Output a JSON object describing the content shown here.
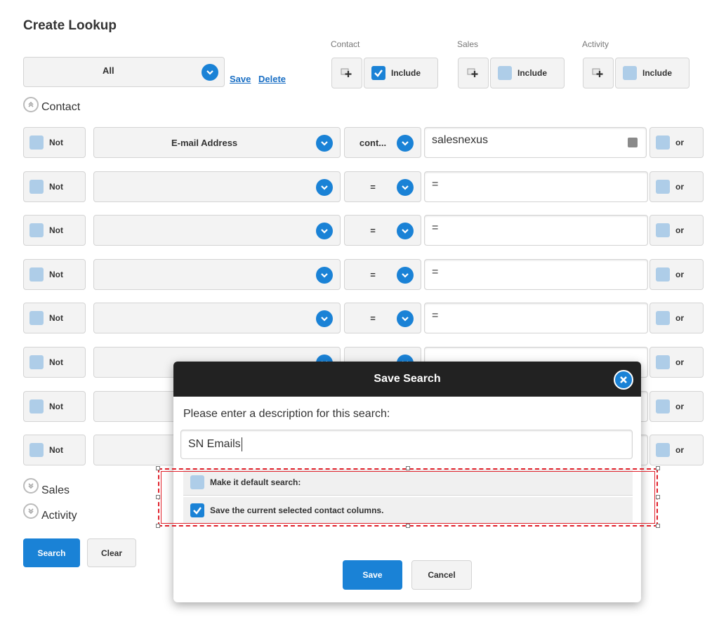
{
  "page": {
    "title": "Create Lookup"
  },
  "columns": {
    "contact": "Contact",
    "sales": "Sales",
    "activity": "Activity"
  },
  "lookup": {
    "selected": "All",
    "save_link": "Save",
    "delete_link": "Delete"
  },
  "include": {
    "label": "Include",
    "contact_checked": true,
    "sales_checked": false,
    "activity_checked": false
  },
  "sections": {
    "contact": "Contact",
    "sales": "Sales",
    "activity": "Activity"
  },
  "filters": {
    "not_label": "Not",
    "or_label": "or",
    "rows": [
      {
        "field": "E-mail Address",
        "operator": "cont...",
        "value": "salesnexus"
      },
      {
        "field": "",
        "operator": "=",
        "value": "="
      },
      {
        "field": "",
        "operator": "=",
        "value": "="
      },
      {
        "field": "",
        "operator": "=",
        "value": "="
      },
      {
        "field": "",
        "operator": "=",
        "value": "="
      },
      {
        "field": "",
        "operator": "",
        "value": ""
      },
      {
        "field": "",
        "operator": "",
        "value": ""
      },
      {
        "field": "",
        "operator": "",
        "value": ""
      }
    ]
  },
  "actions": {
    "search": "Search",
    "clear": "Clear"
  },
  "dialog": {
    "title": "Save Search",
    "prompt": "Please enter a description for this search:",
    "description_value": "SN Emails",
    "option_default": "Make it default search:",
    "option_default_checked": false,
    "option_columns": "Save the current selected contact columns.",
    "option_columns_checked": true,
    "save": "Save",
    "cancel": "Cancel"
  },
  "colors": {
    "accent": "#1a82d6",
    "header": "#222222",
    "highlight": "#e0202a"
  },
  "icons": [
    "chevron-down-icon",
    "add-icon",
    "check-icon",
    "collapse-icon",
    "expand-icon",
    "close-icon",
    "lookup-icon"
  ]
}
